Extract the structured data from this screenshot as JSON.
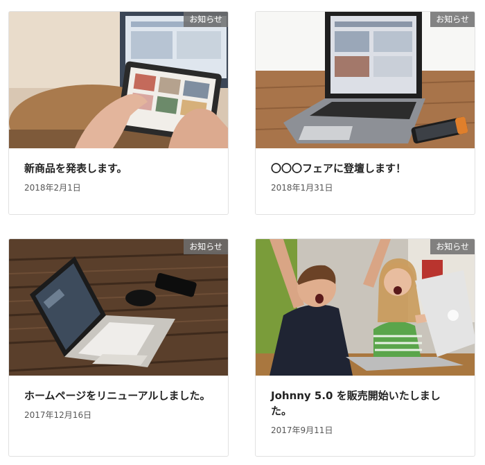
{
  "posts": [
    {
      "category": "お知らせ",
      "title": "新商品を発表します。",
      "date": "2018年2月1日",
      "image": "hands-tablet-photo"
    },
    {
      "category": "お知らせ",
      "title": "〇〇〇フェアに登壇します！",
      "date": "2018年1月31日",
      "image": "laptop-phone-photo"
    },
    {
      "category": "お知らせ",
      "title": "ホームページをリニューアルしました。",
      "date": "2017年12月16日",
      "image": "laptop-mouse-photo"
    },
    {
      "category": "お知らせ",
      "title": "Johnny 5.0 を販売開始いたしました。",
      "date": "2017年9月11日",
      "image": "kids-cheering-photo"
    }
  ]
}
